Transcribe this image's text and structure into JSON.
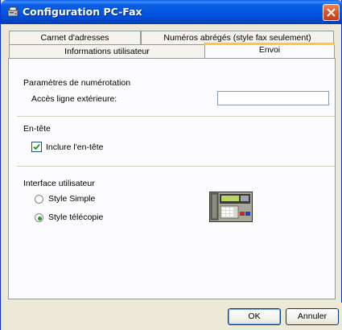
{
  "window": {
    "title": "Configuration PC-Fax"
  },
  "tabs": {
    "row_back": [
      {
        "label": "Carnet d'adresses"
      },
      {
        "label": "Numéros abrégés (style fax seulement)"
      }
    ],
    "row_front": [
      {
        "label": "Informations utilisateur"
      },
      {
        "label": "Envoi",
        "selected": true
      }
    ]
  },
  "dialing": {
    "section_title": "Paramètres de numérotation",
    "outside_line_label": "Accès ligne extérieure:",
    "outside_line_value": ""
  },
  "header": {
    "section_title": "En-tête",
    "include_header_label": "Inclure l'en-tête",
    "include_header_checked": true
  },
  "ui": {
    "section_title": "Interface utilisateur",
    "options": [
      {
        "label": "Style Simple",
        "selected": false
      },
      {
        "label": "Style télécopie",
        "selected": true
      }
    ],
    "preview_icon": "fax-machine-icon"
  },
  "buttons": {
    "ok_label": "OK",
    "cancel_label": "Annuler"
  },
  "colors": {
    "titlebar": "#0054e3",
    "close_button": "#d7542b",
    "active_tab_highlight": "#ffc83c",
    "radio_dot": "#21a121"
  }
}
